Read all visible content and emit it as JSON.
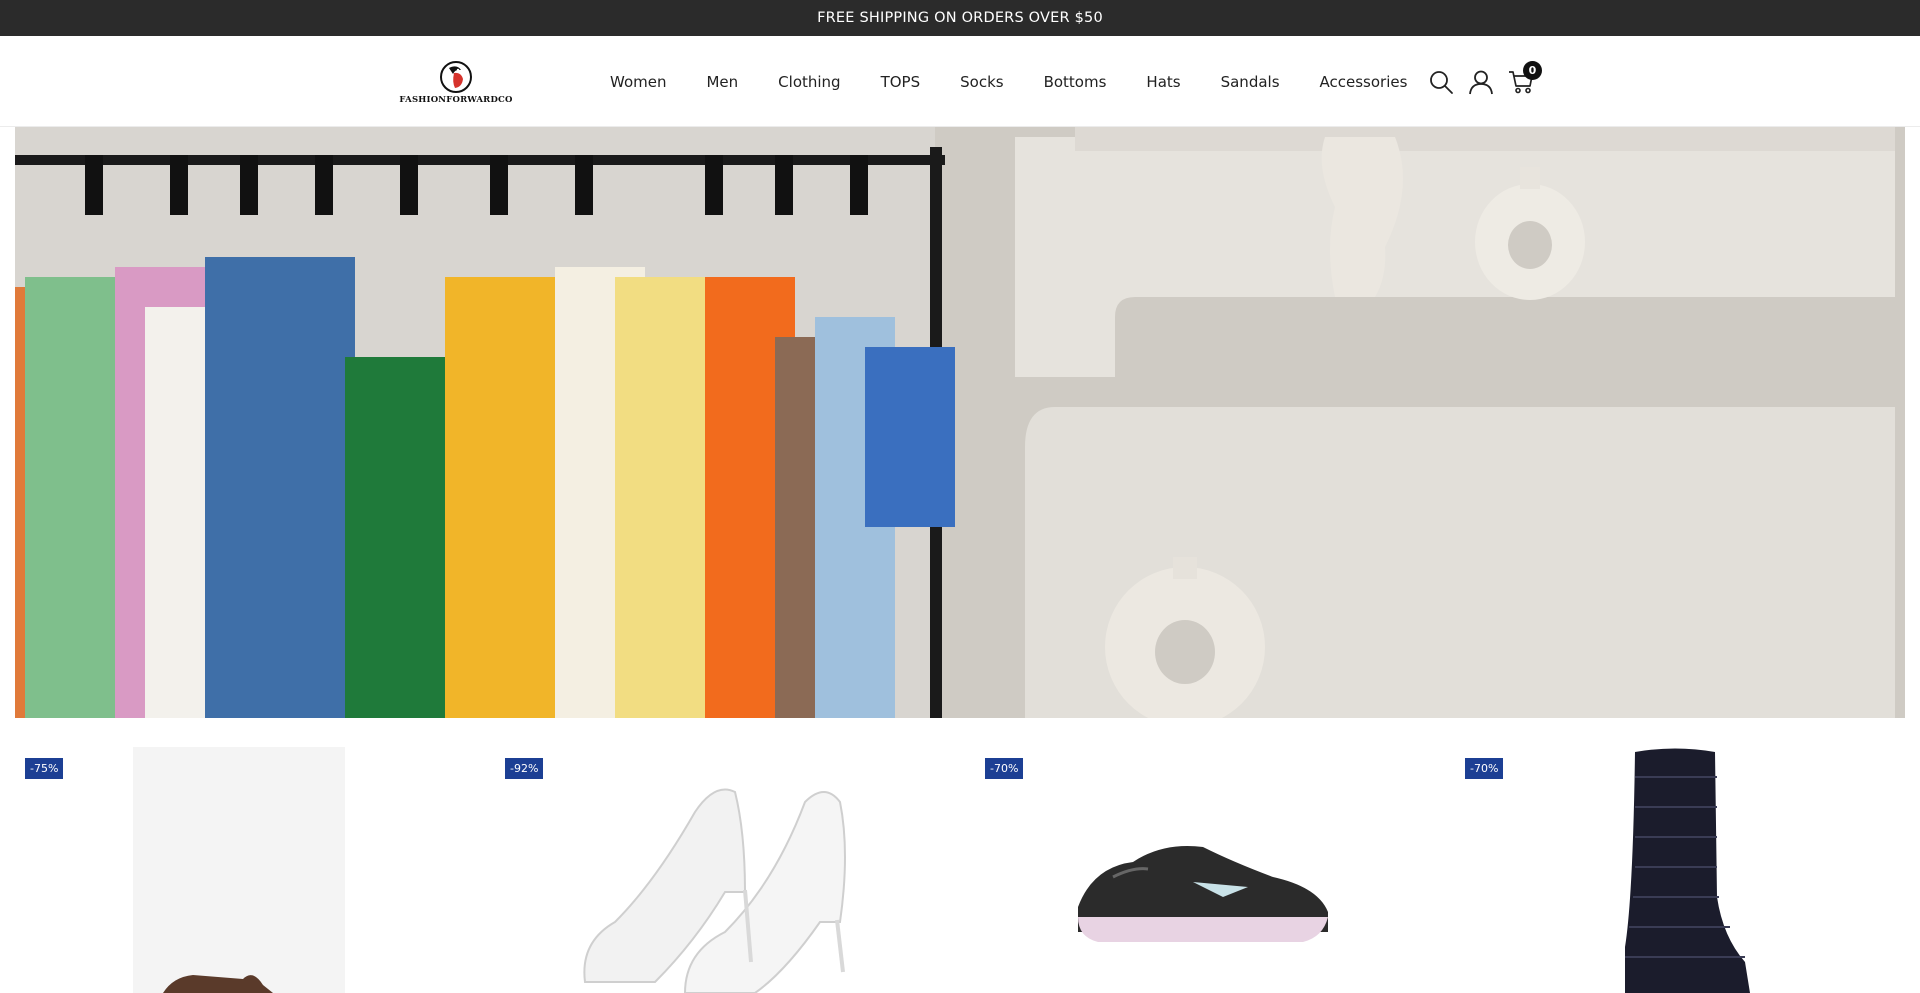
{
  "announcement": {
    "text": "FREE SHIPPING ON ORDERS OVER $50"
  },
  "brand": {
    "name": "FASHIONFORWARDCO"
  },
  "nav": {
    "items": [
      "Women",
      "Men",
      "Clothing",
      "TOPS",
      "Socks",
      "Bottoms",
      "Hats",
      "Sandals",
      "Accessories"
    ]
  },
  "header_icons": {
    "search": "search-icon",
    "account": "user-icon",
    "cart": "cart-icon",
    "cart_count": "0"
  },
  "hero": {
    "image": "clothing-rack-hero"
  },
  "products": [
    {
      "badge": "-75%",
      "image": "brown-loafer-shoe"
    },
    {
      "badge": "-92%",
      "image": "white-kitten-heel-pump"
    },
    {
      "badge": "-70%",
      "image": "black-running-sneaker"
    },
    {
      "badge": "-70%",
      "image": "black-quilted-snow-boot"
    }
  ],
  "colors": {
    "announce_bg": "#2b2b2b",
    "badge_bg": "#1c3f94"
  }
}
